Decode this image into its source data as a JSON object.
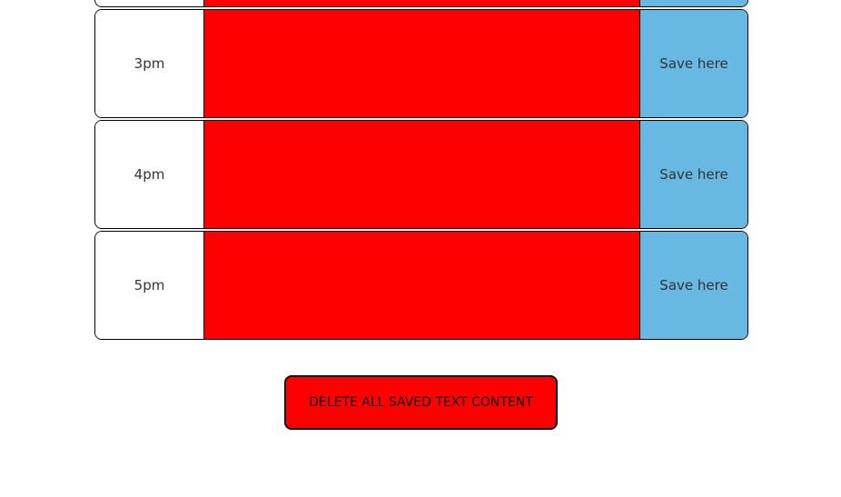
{
  "schedule": {
    "rows": [
      {
        "hour": "",
        "save_label": ""
      },
      {
        "hour": "3pm",
        "save_label": "Save here"
      },
      {
        "hour": "4pm",
        "save_label": "Save here"
      },
      {
        "hour": "5pm",
        "save_label": "Save here"
      }
    ]
  },
  "delete_button": {
    "label": "DELETE ALL SAVED TEXT CONTENT"
  },
  "colors": {
    "textarea": "#ff0000",
    "save": "#67b9e3",
    "delete": "#ff0000"
  }
}
